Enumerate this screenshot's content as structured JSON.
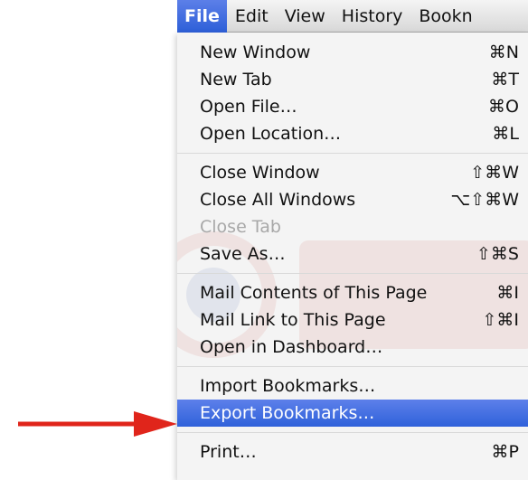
{
  "menubar": {
    "items": [
      {
        "label": "File",
        "active": true
      },
      {
        "label": "Edit"
      },
      {
        "label": "View"
      },
      {
        "label": "History"
      },
      {
        "label": "Bookn"
      }
    ]
  },
  "file_menu": {
    "groups": [
      [
        {
          "label": "New Window",
          "shortcut": "⌘N"
        },
        {
          "label": "New Tab",
          "shortcut": "⌘T"
        },
        {
          "label": "Open File…",
          "shortcut": "⌘O"
        },
        {
          "label": "Open Location…",
          "shortcut": "⌘L"
        }
      ],
      [
        {
          "label": "Close Window",
          "shortcut": "⇧⌘W"
        },
        {
          "label": "Close All Windows",
          "shortcut": "⌥⇧⌘W"
        },
        {
          "label": "Close Tab",
          "shortcut": "",
          "disabled": true
        },
        {
          "label": "Save As…",
          "shortcut": "⇧⌘S"
        }
      ],
      [
        {
          "label": "Mail Contents of This Page",
          "shortcut": "⌘I"
        },
        {
          "label": "Mail Link to This Page",
          "shortcut": "⇧⌘I"
        },
        {
          "label": "Open in Dashboard…",
          "shortcut": ""
        }
      ],
      [
        {
          "label": "Import Bookmarks…",
          "shortcut": ""
        },
        {
          "label": "Export Bookmarks…",
          "shortcut": "",
          "highlighted": true
        }
      ],
      [
        {
          "label": "Print…",
          "shortcut": "⌘P"
        }
      ]
    ]
  },
  "annotation": {
    "arrow_color": "#e0251b"
  }
}
